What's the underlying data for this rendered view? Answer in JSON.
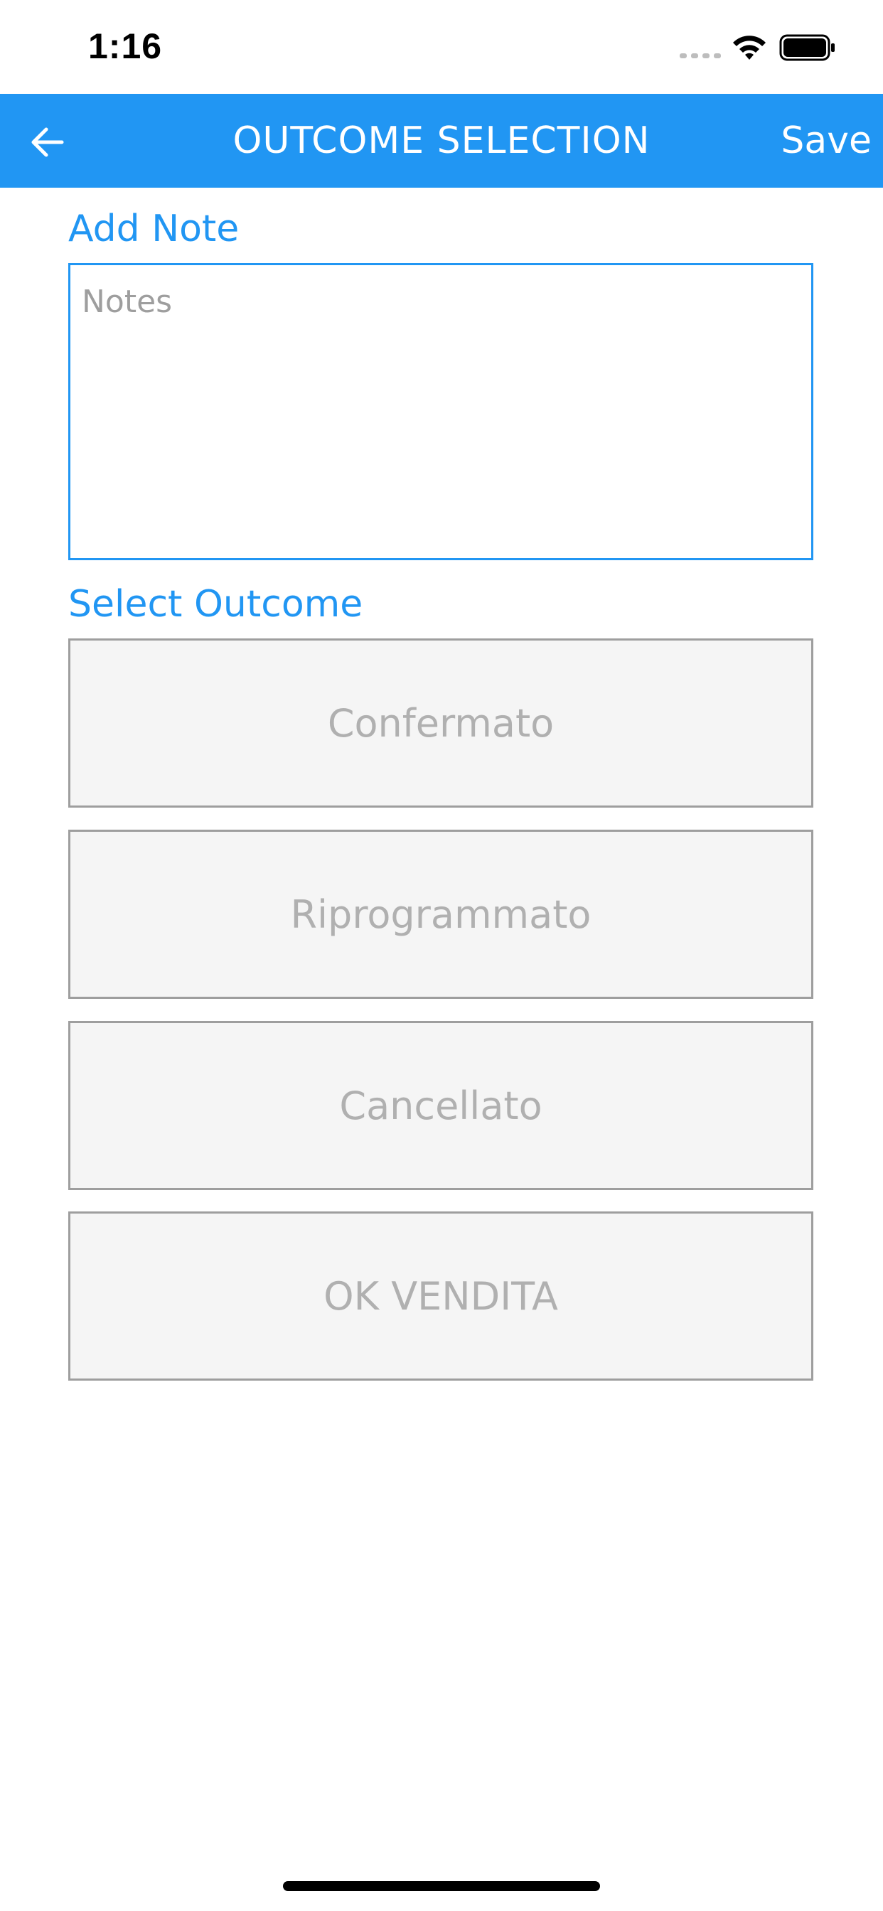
{
  "status_bar": {
    "time": "1:16"
  },
  "app_bar": {
    "title": "OUTCOME SELECTION",
    "save_label": "Save",
    "background_color": "#2196f3",
    "back_icon": "arrow-left-icon"
  },
  "note_section": {
    "label": "Add Note",
    "placeholder": "Notes",
    "value": ""
  },
  "outcome_section": {
    "label": "Select Outcome",
    "options": [
      {
        "label": "Confermato"
      },
      {
        "label": "Riprogrammato"
      },
      {
        "label": "Cancellato"
      },
      {
        "label": "OK VENDITA"
      }
    ]
  },
  "colors": {
    "accent": "#2196f3",
    "option_background": "#f5f5f5",
    "option_border": "#9e9e9e",
    "option_text": "#b0b0b0"
  }
}
